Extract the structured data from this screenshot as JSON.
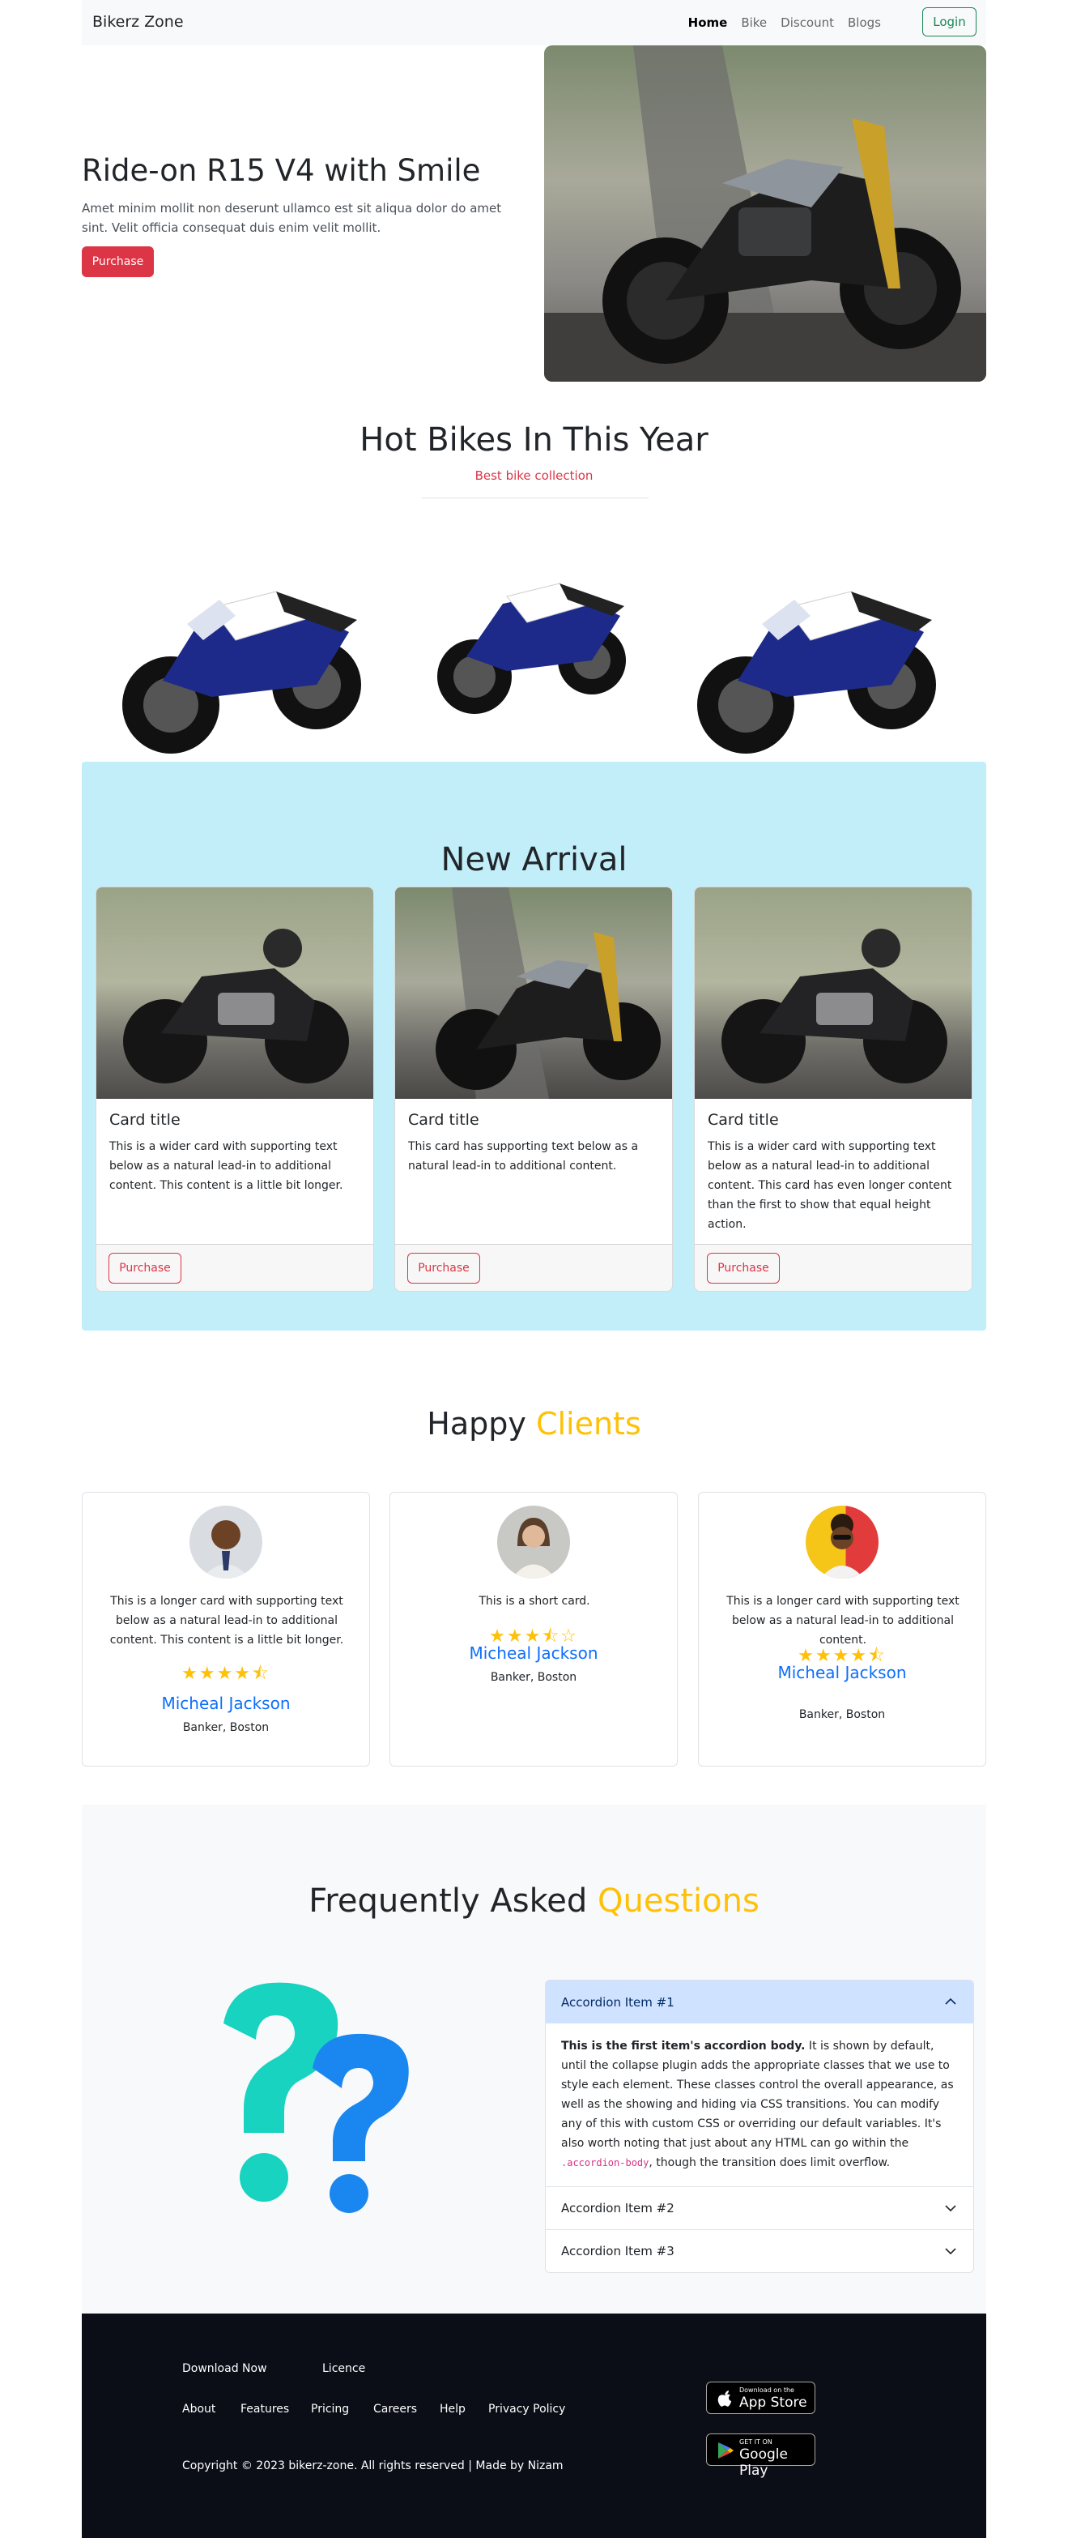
{
  "navbar": {
    "brand": "Bikerz Zone",
    "links": [
      "Home",
      "Bike",
      "Discount",
      "Blogs"
    ],
    "login_label": "Login"
  },
  "hero": {
    "title": "Ride-on R15 V4 with Smile",
    "text": "Amet minim mollit non deserunt ullamco est sit aliqua dolor do amet sint. Velit officia consequat duis enim velit mollit.",
    "button_label": "Purchase"
  },
  "hot_bikes": {
    "title": "Hot Bikes In This Year",
    "subtitle": "Best bike collection"
  },
  "new_arrival": {
    "title": "New Arrival",
    "cards": [
      {
        "title": "Card title",
        "text": "This is a wider card with supporting text below as a natural lead-in to additional content. This content is a little bit longer.",
        "button_label": "Purchase"
      },
      {
        "title": "Card title",
        "text": "This card has supporting text below as a natural lead-in to additional content.",
        "button_label": "Purchase"
      },
      {
        "title": "Card title",
        "text": "This is a wider card with supporting text below as a natural lead-in to additional content. This card has even longer content than the first to show that equal height action.",
        "button_label": "Purchase"
      }
    ]
  },
  "clients": {
    "title_main": "Happy",
    "title_accent": "Clients",
    "items": [
      {
        "text": "This is a longer card with supporting text below as a natural lead-in to additional content. This content is a little bit longer.",
        "rating": 4.5,
        "name": "Micheal Jackson",
        "role": "Banker, Boston"
      },
      {
        "text": "This is a short card.",
        "rating": 3.5,
        "name": "Micheal Jackson",
        "role": "Banker, Boston"
      },
      {
        "text": "This is a longer card with supporting text below as a natural lead-in to additional content.",
        "rating": 4.5,
        "name": "Micheal Jackson",
        "role": "Banker, Boston"
      }
    ]
  },
  "faq": {
    "title_main": "Frequently Asked",
    "title_accent": "Questions",
    "items": [
      {
        "label": "Accordion Item #1",
        "open": true
      },
      {
        "label": "Accordion Item #2",
        "open": false
      },
      {
        "label": "Accordion Item #3",
        "open": false
      }
    ],
    "body_strong": "This is the first item's accordion body.",
    "body_text": " It is shown by default, until the collapse plugin adds the appropriate classes that we use to style each element. These classes control the overall appearance, as well as the showing and hiding via CSS transitions. You can modify any of this with custom CSS or overriding our default variables. It's also worth noting that just about any HTML can go within the ",
    "body_code": ".accordion-body",
    "body_tail": ", though the transition does limit overflow."
  },
  "footer": {
    "links_row1": [
      "Download Now",
      "Licence"
    ],
    "links_row2": [
      "About",
      "Features",
      "Pricing",
      "Careers",
      "Help",
      "Privacy Policy"
    ],
    "appstore_small": "Download on the",
    "appstore_big": "App Store",
    "googleplay_small": "GET IT ON",
    "googleplay_big": "Google Play",
    "copyright": "Copyright © 2023 bikerz-zone. All rights reserved | Made by Nizam"
  },
  "colors": {
    "primary": "#0d6efd",
    "danger": "#dc3545",
    "success": "#198754",
    "warning": "#ffc107",
    "info_bg": "#c2eef9",
    "footer_bg": "#0b0d17"
  }
}
